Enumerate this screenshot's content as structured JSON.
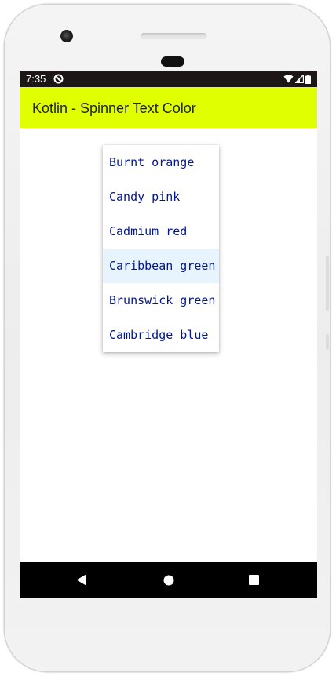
{
  "status_bar": {
    "time": "7:35",
    "icons": [
      "circle-slash-icon",
      "wifi-icon",
      "cellular-signal-icon",
      "battery-icon"
    ]
  },
  "app_bar": {
    "title": "Kotlin - Spinner Text Color",
    "background_color": "#e0ff00"
  },
  "spinner_dropdown": {
    "text_color": "#00158f",
    "selected_index": 3,
    "items": [
      {
        "label": "Burnt orange"
      },
      {
        "label": "Candy pink"
      },
      {
        "label": "Cadmium red"
      },
      {
        "label": "Caribbean green"
      },
      {
        "label": "Brunswick green"
      },
      {
        "label": "Cambridge blue"
      }
    ]
  },
  "nav_bar": {
    "buttons": [
      "back-icon",
      "home-icon",
      "recents-icon"
    ]
  }
}
